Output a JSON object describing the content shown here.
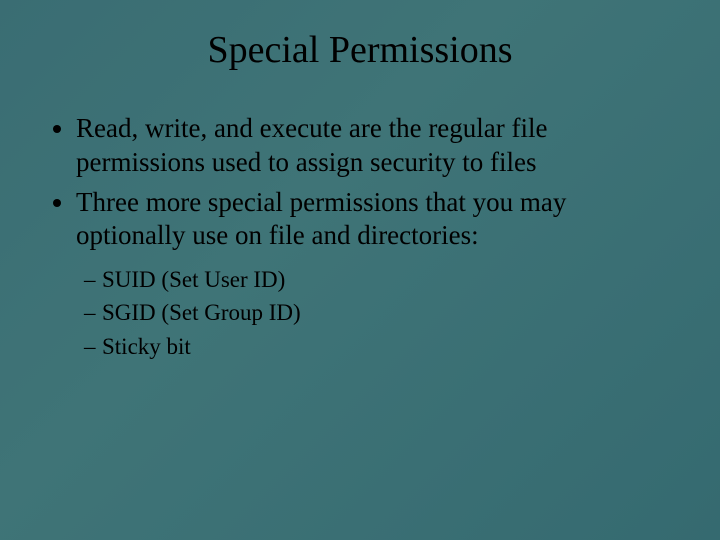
{
  "title": "Special Permissions",
  "bullets": [
    "Read, write, and execute are the regular file permissions used to assign security to files",
    "Three more special permissions that you may optionally use on file and directories:"
  ],
  "sub_bullets": [
    "SUID (Set User ID)",
    "SGID (Set Group ID)",
    "Sticky bit"
  ]
}
